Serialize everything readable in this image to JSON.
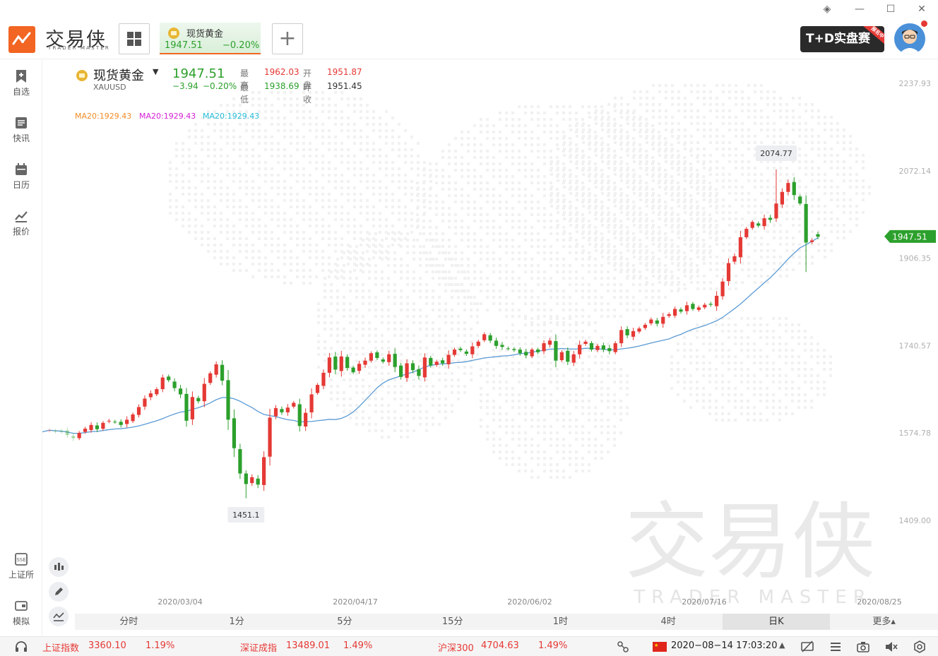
{
  "brand": {
    "name": "交易侠",
    "sub": "TRADER MASTER"
  },
  "tab": {
    "name": "现货黄金",
    "price": "1947.51",
    "change": "−0.20%"
  },
  "banner": {
    "text": "T+D实盘赛",
    "ribbon": "报名中"
  },
  "sidebar": {
    "items": [
      {
        "label": "自选"
      },
      {
        "label": "快讯"
      },
      {
        "label": "日历"
      },
      {
        "label": "报价"
      },
      {
        "label": "上证所"
      },
      {
        "label": "模拟"
      }
    ]
  },
  "ticker": {
    "name": "现货黄金",
    "symbol": "XAUUSD",
    "price": "1947.51",
    "change": "−3.94",
    "change_pct": "−0.20%",
    "high_label": "最高",
    "high": "1962.03",
    "open_label": "开盘",
    "open": "1951.87",
    "low_label": "最低",
    "low": "1938.69",
    "prev_label": "昨收",
    "prev": "1951.45"
  },
  "ma": {
    "ma1": "MA20:1929.43",
    "ma2": "MA20:1929.43",
    "ma3": "MA20:1929.43",
    "c1": "#f28c28",
    "c2": "#d61fd6",
    "c3": "#26bcd7"
  },
  "chart_data": {
    "type": "candlestick",
    "yaxis": [
      "2237.93",
      "2072.14",
      "1906.35",
      "1740.57",
      "1574.78",
      "1409.00"
    ],
    "xaxis": [
      "2020/03/04",
      "2020/04/17",
      "2020/06/02",
      "2020/07/16",
      "2020/08/25"
    ],
    "ylim": [
      1409.0,
      2237.93
    ],
    "current_price": "1947.51",
    "high_marker": "2074.77",
    "low_marker": "1451.1",
    "up_color": "#e53935",
    "down_color": "#2ca02c",
    "ma_color": "#5b9bd5",
    "closes": [
      1580,
      1578,
      1577,
      1571,
      1565,
      1575,
      1583,
      1590,
      1582,
      1594,
      1598,
      1596,
      1590,
      1600,
      1610,
      1624,
      1640,
      1650,
      1658,
      1680,
      1675,
      1660,
      1648,
      1598,
      1643,
      1635,
      1668,
      1688,
      1705,
      1674,
      1600,
      1546,
      1498,
      1478,
      1491,
      1477,
      1529,
      1604,
      1622,
      1614,
      1623,
      1632,
      1588,
      1613,
      1648,
      1666,
      1689,
      1718,
      1695,
      1720,
      1698,
      1690,
      1706,
      1712,
      1726,
      1717,
      1710,
      1724,
      1700,
      1681,
      1707,
      1694,
      1683,
      1718,
      1703,
      1710,
      1707,
      1723,
      1733,
      1732,
      1725,
      1739,
      1748,
      1762,
      1750,
      1740,
      1738,
      1735,
      1732,
      1726,
      1722,
      1733,
      1728,
      1745,
      1750,
      1712,
      1728,
      1710,
      1724,
      1742,
      1748,
      1733,
      1740,
      1733,
      1730,
      1745,
      1770,
      1760,
      1768,
      1773,
      1780,
      1790,
      1782,
      1795,
      1800,
      1810,
      1805,
      1817,
      1810,
      1813,
      1818,
      1818,
      1835,
      1862,
      1897,
      1910,
      1946,
      1962,
      1975,
      1968,
      1982,
      1979,
      2010,
      2032,
      2049,
      2026,
      2010,
      1936,
      1940,
      1947
    ]
  },
  "watermark": {
    "main": "交易侠",
    "sub": "TRADER MASTER"
  },
  "timeframes": [
    "分时",
    "1分",
    "5分",
    "15分",
    "1时",
    "4时",
    "日K",
    "更多▴"
  ],
  "active_tf": "日K",
  "status": {
    "i1_name": "上证指数",
    "i1_val": "3360.10",
    "i1_pct": "1.19%",
    "i2_name": "深证成指",
    "i2_val": "13489.01",
    "i2_pct": "1.49%",
    "i3_name": "沪深300",
    "i3_val": "4704.63",
    "i3_pct": "1.49%",
    "datetime": "2020−08−14 17:03:20"
  }
}
